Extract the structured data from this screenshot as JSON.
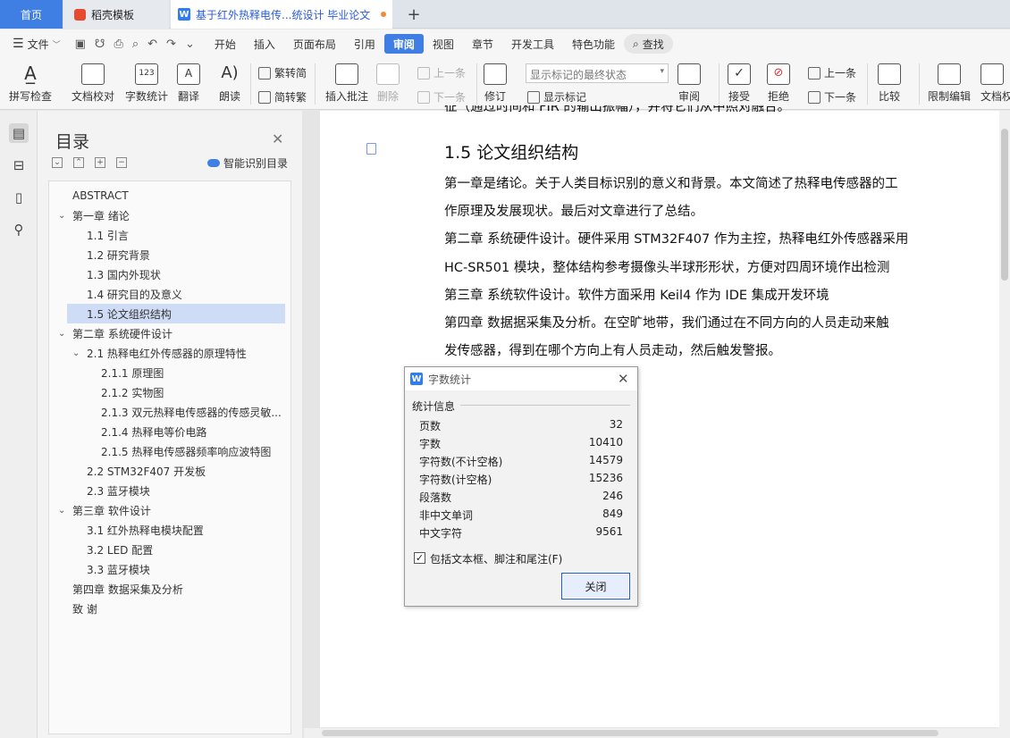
{
  "tabs": {
    "home": "首页",
    "template": "稻壳模板",
    "document": "基于红外热释电传...统设计 毕业论文",
    "new_tab_icon": "plus-icon"
  },
  "menu": {
    "file": "文件",
    "items": [
      "开始",
      "插入",
      "页面布局",
      "引用",
      "审阅",
      "视图",
      "章节",
      "开发工具",
      "特色功能"
    ],
    "active": "审阅",
    "search": "查找"
  },
  "ribbon": {
    "spellcheck": "拼写检查",
    "proofread": "文档校对",
    "wordcount": "字数统计",
    "translate": "翻译",
    "read_aloud": "朗读",
    "trad_to_simp": "繁转简",
    "simp_to_trad": "简转繁",
    "insert_comment": "插入批注",
    "delete": "删除",
    "prev_comment": "上一条",
    "next_comment": "下一条",
    "revise": "修订",
    "markup_mode": "显示标记的最终状态",
    "show_markup": "显示标记",
    "review": "审阅",
    "accept": "接受",
    "reject": "拒绝",
    "prev_change": "上一条",
    "next_change": "下一条",
    "compare": "比较",
    "restrict_edit": "限制编辑",
    "doc_permission": "文档权"
  },
  "toc": {
    "title": "目录",
    "smart_recognize": "智能识别目录",
    "items": [
      {
        "label": "ABSTRACT"
      },
      {
        "label": "第一章  绪论"
      },
      {
        "label": "1.1 引言"
      },
      {
        "label": "1.2 研究背景"
      },
      {
        "label": "1.3  国内外现状"
      },
      {
        "label": "1.4  研究目的及意义"
      },
      {
        "label": "1.5 论文组织结构"
      },
      {
        "label": "第二章  系统硬件设计"
      },
      {
        "label": "2.1  热释电红外传感器的原理特性"
      },
      {
        "label": "2.1.1 原理图"
      },
      {
        "label": "2.1.2 实物图"
      },
      {
        "label": "2.1.3 双元热释电传感器的传感灵敏..."
      },
      {
        "label": "2.1.4 热释电等价电路"
      },
      {
        "label": "2.1.5 热释电传感器频率响应波特图"
      },
      {
        "label": "2.2 STM32F407 开发板"
      },
      {
        "label": "2.3 蓝牙模块"
      },
      {
        "label": "第三章   软件设计"
      },
      {
        "label": "3.1  红外热释电模块配置"
      },
      {
        "label": "3.2 LED 配置"
      },
      {
        "label": "3.3  蓝牙模块"
      },
      {
        "label": "第四章  数据采集及分析"
      },
      {
        "label": "致   谢"
      }
    ],
    "selected": "1.5 论文组织结构"
  },
  "document": {
    "top_partial": "征（通过时间和 FIR 的输出振幅），并将它们从中照对融合。",
    "section_title": "1.5 论文组织结构",
    "lines": [
      "第一章是绪论。关于人类目标识别的意义和背景。本文简述了热释电传感器的工",
      "作原理及发展现状。最后对文章进行了总结。",
      "第二章  系统硬件设计。硬件采用 STM32F407 作为主控，热释电红外传感器采用",
      "HC-SR501 模块，整体结构参考摄像头半球形形状，方便对四周环境作出检测",
      "第三章  系统软件设计。软件方面采用 Keil4 作为 IDE 集成开发环境",
      "第四章  数据据采集及分析。在空旷地带，我们通过在不同方向的人员走动来触",
      "发传感器，得到在哪个方向上有人员走动，然后触发警报。"
    ]
  },
  "dialog": {
    "title": "字数统计",
    "group_label": "统计信息",
    "stats": [
      {
        "label": "页数",
        "value": "32"
      },
      {
        "label": "字数",
        "value": "10410"
      },
      {
        "label": "字符数(不计空格)",
        "value": "14579"
      },
      {
        "label": "字符数(计空格)",
        "value": "15236"
      },
      {
        "label": "段落数",
        "value": "246"
      },
      {
        "label": "非中文单词",
        "value": "849"
      },
      {
        "label": "中文字符",
        "value": "9561"
      }
    ],
    "checkbox_label": "包括文本框、脚注和尾注(F)",
    "checkbox_checked": true,
    "close_button": "关闭"
  },
  "colors": {
    "accent": "#3f7fe3",
    "selected_row": "#cfdcf5"
  }
}
